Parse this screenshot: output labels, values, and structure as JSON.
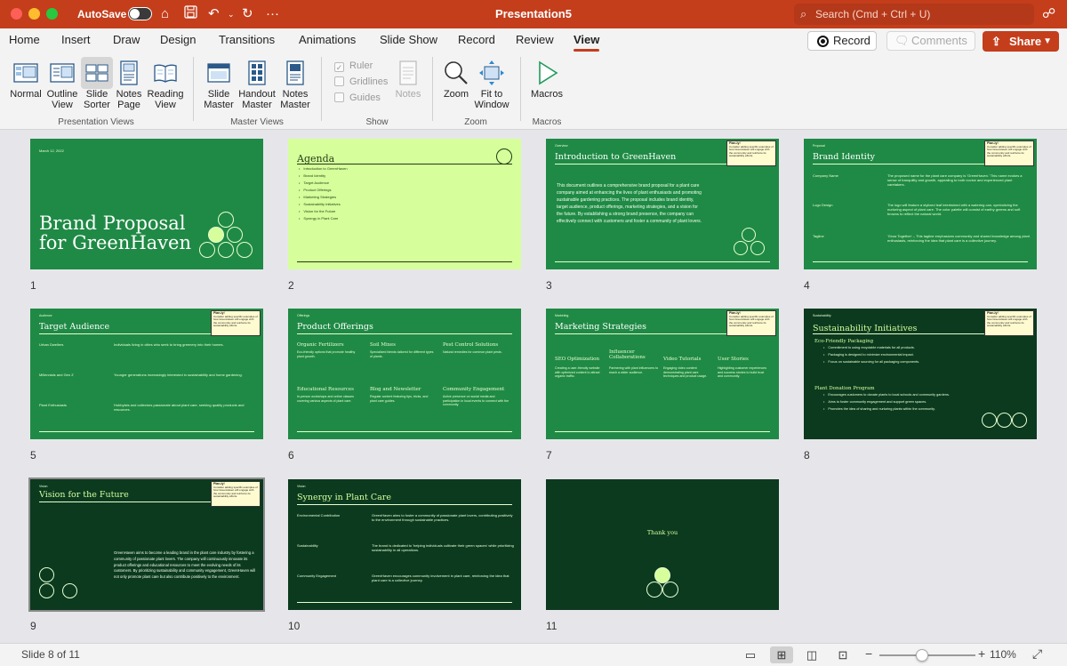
{
  "app": {
    "doc_title": "Presentation5",
    "autosave_label": "AutoSave",
    "search_placeholder": "Search (Cmd + Ctrl + U)"
  },
  "tabs": [
    {
      "label": "Home"
    },
    {
      "label": "Insert"
    },
    {
      "label": "Draw"
    },
    {
      "label": "Design"
    },
    {
      "label": "Transitions"
    },
    {
      "label": "Animations"
    },
    {
      "label": "Slide Show"
    },
    {
      "label": "Record"
    },
    {
      "label": "Review"
    },
    {
      "label": "View"
    }
  ],
  "actions": {
    "record": "Record",
    "comments": "Comments",
    "share": "Share"
  },
  "ribbon": {
    "normal": "Normal",
    "outline_1": "Outline",
    "outline_2": "View",
    "slide_sorter_1": "Slide",
    "slide_sorter_2": "Sorter",
    "notes_page_1": "Notes",
    "notes_page_2": "Page",
    "reading_1": "Reading",
    "reading_2": "View",
    "slide_master_1": "Slide",
    "slide_master_2": "Master",
    "handout_master_1": "Handout",
    "handout_master_2": "Master",
    "notes_master_1": "Notes",
    "notes_master_2": "Master",
    "ruler": "Ruler",
    "gridlines": "Gridlines",
    "guides": "Guides",
    "notes": "Notes",
    "zoom": "Zoom",
    "fit_1": "Fit to",
    "fit_2": "Window",
    "macros": "Macros",
    "groups": {
      "presentation_views": "Presentation Views",
      "master_views": "Master Views",
      "show": "Show",
      "zoom": "Zoom",
      "macros": "Macros"
    }
  },
  "slides": {
    "s1": {
      "num": "1",
      "date": "March 12, 2022",
      "title_1": "Brand Proposal",
      "title_2": "for GreenHaven"
    },
    "s2": {
      "num": "2",
      "title": "Agenda",
      "items": [
        "Introduction to GreenHaven",
        "Brand Identity",
        "Target Audience",
        "Product Offerings",
        "Marketing Strategies",
        "Sustainability Initiatives",
        "Vision for the Future",
        "Synergy in Plant Care"
      ]
    },
    "s3": {
      "num": "3",
      "kicker": "Overview",
      "title": "Introduction to GreenHaven",
      "body": "This document outlines a comprehensive brand proposal for a plant care company aimed at enhancing the lives of plant enthusiasts and promoting sustainable gardening practices. The proposal includes brand identity, target audience, product offerings, marketing strategies, and a vision for the future. By establishing a strong brand presence, the company can effectively connect with customers and foster a community of plant lovers."
    },
    "s4": {
      "num": "4",
      "kicker": "Proposal",
      "title": "Brand Identity",
      "rows": [
        {
          "label": "Company Name",
          "text": "The proposed name for the plant care company is 'GreenHaven.' This name evokes a sense of tranquility and growth, appealing to both novice and experienced plant caretakers."
        },
        {
          "label": "Logo Design",
          "text": "The logo will feature a stylized leaf intertwined with a watering can, symbolizing the nurturing aspect of plant care. The color palette will consist of earthy greens and soft browns to reflect the natural world."
        },
        {
          "label": "Tagline",
          "text": "'Grow Together' – This tagline emphasizes community and shared knowledge among plant enthusiasts, reinforcing the idea that plant care is a collective journey."
        }
      ]
    },
    "s5": {
      "num": "5",
      "kicker": "Audience",
      "title": "Target Audience",
      "rows": [
        {
          "label": "Urban Dwellers",
          "text": "Individuals living in cities who seek to bring greenery into their homes."
        },
        {
          "label": "Millennials and Gen Z",
          "text": "Younger generations increasingly interested in sustainability and home gardening."
        },
        {
          "label": "Plant Enthusiasts",
          "text": "Hobbyists and collectors passionate about plant care, seeking quality products and resources."
        }
      ]
    },
    "s6": {
      "num": "6",
      "kicker": "Offerings",
      "title": "Product Offerings",
      "cols": [
        {
          "head": "Organic Fertilizers",
          "text": "Eco-friendly options that promote healthy plant growth."
        },
        {
          "head": "Soil Mixes",
          "text": "Specialized blends tailored for different types of plants."
        },
        {
          "head": "Pest Control Solutions",
          "text": "Natural remedies for common plant pests."
        },
        {
          "head": "Educational Resources",
          "text": "In-person workshops and online classes covering various aspects of plant care."
        },
        {
          "head": "Blog and Newsletter",
          "text": "Regular content featuring tips, tricks, and plant care guides."
        },
        {
          "head": "Community Engagement",
          "text": "Active presence on social media and participation in local events to connect with the community."
        }
      ]
    },
    "s7": {
      "num": "7",
      "kicker": "Marketing",
      "title": "Marketing Strategies",
      "cols": [
        {
          "head": "SEO Optimization",
          "text": "Creating a user-friendly website with optimized content to attract organic traffic."
        },
        {
          "head": "Influencer Collaborations",
          "text": "Partnering with plant influencers to reach a wider audience."
        },
        {
          "head": "Video Tutorials",
          "text": "Engaging video content demonstrating plant care techniques and product usage."
        },
        {
          "head": "User Stories",
          "text": "Highlighting customer experiences and success stories to build trust and community."
        }
      ]
    },
    "s8": {
      "num": "8",
      "kicker": "Sustainability",
      "title": "Sustainability Initiatives",
      "sub1": "Eco-Friendly Packaging",
      "items1": [
        "Commitment to using recyclable materials for all products.",
        "Packaging is designed to minimize environmental impact.",
        "Focus on sustainable sourcing for all packaging components."
      ],
      "sub2": "Plant Donation Program",
      "items2": [
        "Encourages customers to donate plants to local schools and community gardens.",
        "Aims to foster community engagement and support green spaces.",
        "Promotes the idea of sharing and nurturing plants within the community."
      ]
    },
    "s9": {
      "num": "9",
      "kicker": "Vision",
      "title": "Vision for the Future",
      "body": "GreenHaven aims to become a leading brand in the plant care industry by fostering a community of passionate plant lovers. The company will continuously innovate its product offerings and educational resources to meet the evolving needs of its customers. By prioritizing sustainability and community engagement, GreenHaven will not only promote plant care but also contribute positively to the environment."
    },
    "s10": {
      "num": "10",
      "kicker": "Vision",
      "title": "Synergy in Plant Care",
      "rows": [
        {
          "label": "Environmental Contribution",
          "text": "GreenHaven aims to foster a community of passionate plant lovers, contributing positively to the environment through sustainable practices."
        },
        {
          "label": "Sustainability",
          "text": "The brand is dedicated to 'helping individuals cultivate their green spaces' while prioritizing sustainability in all operations."
        },
        {
          "label": "Community Engagement",
          "text": "GreenHaven encourages community involvement in plant care, reinforcing the idea that plant care is a collective journey."
        }
      ]
    },
    "s11": {
      "num": "11",
      "text": "Thank you"
    },
    "note_title": "Plan-ly!",
    "note_text": "Consider adding specific examples of how GreenHaven will engage with the community and reinforce its sustainability efforts."
  },
  "status": {
    "slide_counter": "Slide 8 of 11",
    "zoom": "110%",
    "zoom_level_percent": 110
  }
}
